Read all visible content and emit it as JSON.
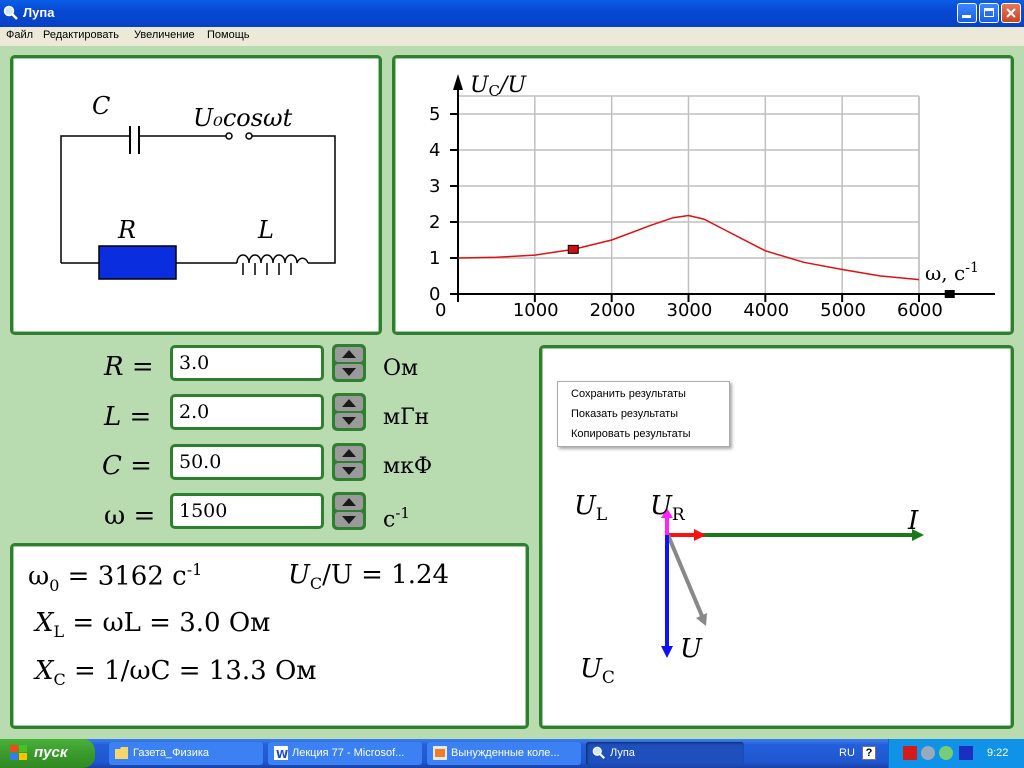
{
  "window": {
    "title": "Лупа"
  },
  "menu": {
    "items": [
      "Файл",
      "Редактировать",
      "Увеличение",
      "Помощь"
    ]
  },
  "circuit": {
    "label_C": "C",
    "label_source": "U₀cosωt",
    "label_R": "R",
    "label_L": "L",
    "resistor_color": "#0b2de0"
  },
  "plot": {
    "ylabel_main": "U",
    "ylabel_sub": "C",
    "ylabel_tail": "/U",
    "xlabel": "ω, c",
    "xlabel_exp": "-1"
  },
  "chart_data": {
    "type": "line",
    "series": [
      {
        "values_x": [
          0,
          500,
          1000,
          1500,
          2000,
          2500,
          2800,
          3000,
          3200,
          3500,
          4000,
          4500,
          5000,
          5500,
          6000
        ],
        "values_y": [
          1.0,
          1.02,
          1.08,
          1.24,
          1.5,
          1.9,
          2.12,
          2.18,
          2.08,
          1.75,
          1.2,
          0.88,
          0.68,
          0.5,
          0.4
        ]
      }
    ],
    "marker": {
      "x": 1500,
      "y": 1.24
    },
    "xmarker": 6400,
    "xticks": [
      0,
      1000,
      2000,
      3000,
      4000,
      5000,
      6000
    ],
    "yticks": [
      0,
      1,
      2,
      3,
      4,
      5
    ],
    "xlim": [
      0,
      6000
    ],
    "ylim": [
      0,
      5.5
    ],
    "grid": true,
    "color": "#e01010"
  },
  "params": [
    {
      "sym": "R",
      "value": "3.0",
      "unit": "Ом",
      "unit_exp": ""
    },
    {
      "sym": "L",
      "value": "2.0",
      "unit": "мГн",
      "unit_exp": ""
    },
    {
      "sym": "C",
      "value": "50.0",
      "unit": "мкФ",
      "unit_exp": ""
    },
    {
      "sym": "ω",
      "value": "1500",
      "unit": "c",
      "unit_exp": "-1"
    }
  ],
  "results": {
    "omega0_sym": "ω",
    "omega0_sub": "0",
    "omega0_eq": " =  3162  c",
    "omega0_exp": "-1",
    "ratio_sym": "U",
    "ratio_sub": "C",
    "ratio_tail": "/U =  1.24",
    "xl_sym": "X",
    "xl_sub": "L",
    "xl_eq": " = ωL = 3.0  Ом",
    "xc_sym": "X",
    "xc_sub": "C",
    "xc_eq": " = 1/ωC = 13.3  Ом"
  },
  "phasor": {
    "UL": "U",
    "UL_sub": "L",
    "UR": "U",
    "UR_sub": "R",
    "I": "I",
    "U": "U",
    "UC": "U",
    "UC_sub": "C",
    "colors": {
      "UL": "#ff22ff",
      "UR": "#ff1010",
      "I": "#1a7a1a",
      "UC": "#1010ff",
      "U": "#888888"
    }
  },
  "context_menu": {
    "items": [
      "Сохранить результаты",
      "Показать результаты",
      "Копировать результаты"
    ]
  },
  "taskbar": {
    "start": "пуск",
    "tasks": [
      "Газета_Физика",
      "Лекция 77 - Microsof...",
      "Вынужденные коле...",
      "Лупа"
    ],
    "lang": "RU",
    "time": "9:22"
  }
}
